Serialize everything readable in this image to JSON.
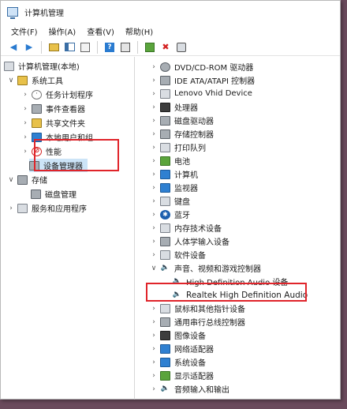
{
  "window": {
    "title": "计算机管理"
  },
  "menu": [
    "文件(F)",
    "操作(A)",
    "查看(V)",
    "帮助(H)"
  ],
  "toolbar_icons": [
    "back-arrow-icon",
    "forward-arrow-icon",
    "up-folder-icon",
    "show-hide-tree-icon",
    "properties-icon",
    "help-icon",
    "show-hidden-icon",
    "update-driver-icon",
    "uninstall-icon",
    "scan-hardware-icon"
  ],
  "left_tree": [
    {
      "label": "计算机管理(本地)",
      "icon": "computer-manage-icon"
    },
    {
      "label": "系统工具",
      "icon": "tools-icon"
    },
    {
      "label": "任务计划程序",
      "icon": "clock-icon"
    },
    {
      "label": "事件查看器",
      "icon": "event-viewer-icon"
    },
    {
      "label": "共享文件夹",
      "icon": "shared-folder-icon"
    },
    {
      "label": "本地用户和组",
      "icon": "users-icon"
    },
    {
      "label": "性能",
      "icon": "performance-icon"
    },
    {
      "label": "设备管理器",
      "icon": "device-manager-icon"
    },
    {
      "label": "存储",
      "icon": "storage-icon"
    },
    {
      "label": "磁盘管理",
      "icon": "disk-management-icon"
    },
    {
      "label": "服务和应用程序",
      "icon": "services-icon"
    }
  ],
  "right_tree": [
    {
      "label": "DVD/CD-ROM 驱动器",
      "icon": "dvd-drive-icon"
    },
    {
      "label": "IDE ATA/ATAPI 控制器",
      "icon": "ide-controller-icon"
    },
    {
      "label": "Lenovo Vhid Device",
      "icon": "hid-device-icon"
    },
    {
      "label": "处理器",
      "icon": "processor-icon"
    },
    {
      "label": "磁盘驱动器",
      "icon": "disk-drive-icon"
    },
    {
      "label": "存储控制器",
      "icon": "storage-controller-icon"
    },
    {
      "label": "打印队列",
      "icon": "printer-icon"
    },
    {
      "label": "电池",
      "icon": "battery-icon"
    },
    {
      "label": "计算机",
      "icon": "computer-icon"
    },
    {
      "label": "监视器",
      "icon": "monitor-icon"
    },
    {
      "label": "键盘",
      "icon": "keyboard-icon"
    },
    {
      "label": "蓝牙",
      "icon": "bluetooth-icon"
    },
    {
      "label": "内存技术设备",
      "icon": "memory-icon"
    },
    {
      "label": "人体学输入设备",
      "icon": "hid-icon"
    },
    {
      "label": "软件设备",
      "icon": "software-device-icon"
    },
    {
      "label": "声音、视频和游戏控制器",
      "icon": "speaker-icon"
    },
    {
      "label": "High Definition Audio 设备",
      "icon": "speaker-icon"
    },
    {
      "label": "Realtek High Definition Audio",
      "icon": "speaker-icon"
    },
    {
      "label": "鼠标和其他指针设备",
      "icon": "mouse-icon"
    },
    {
      "label": "通用串行总线控制器",
      "icon": "usb-icon"
    },
    {
      "label": "图像设备",
      "icon": "camera-icon"
    },
    {
      "label": "网络适配器",
      "icon": "network-adapter-icon"
    },
    {
      "label": "系统设备",
      "icon": "system-device-icon"
    },
    {
      "label": "显示适配器",
      "icon": "display-adapter-icon"
    },
    {
      "label": "音频输入和输出",
      "icon": "audio-io-icon"
    }
  ],
  "colors": {
    "selection": "#cce4f7",
    "highlight_box": "#e0242a",
    "background": "#6a4a5c"
  }
}
